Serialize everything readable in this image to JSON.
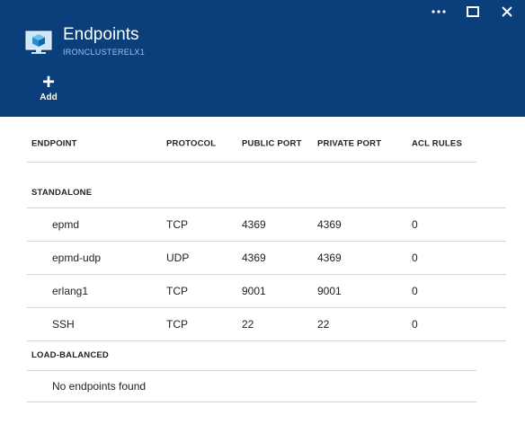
{
  "blade": {
    "title": "Endpoints",
    "subtitle": "IRONCLUSTERELX1",
    "icon": "virtual-machine-icon",
    "window_controls": [
      "ellipsis-icon",
      "maximize-icon",
      "close-icon"
    ]
  },
  "commands": {
    "add_label": "Add"
  },
  "table": {
    "headers": [
      "ENDPOINT",
      "PROTOCOL",
      "PUBLIC PORT",
      "PRIVATE PORT",
      "ACL RULES"
    ],
    "groups": [
      {
        "name": "STANDALONE",
        "rows": [
          [
            "epmd",
            "TCP",
            "4369",
            "4369",
            "0"
          ],
          [
            "epmd-udp",
            "UDP",
            "4369",
            "4369",
            "0"
          ],
          [
            "erlang1",
            "TCP",
            "9001",
            "9001",
            "0"
          ],
          [
            "SSH",
            "TCP",
            "22",
            "22",
            "0"
          ]
        ]
      },
      {
        "name": "LOAD-BALANCED",
        "rows": [],
        "empty_text": "No endpoints found"
      }
    ]
  },
  "colors": {
    "header_bg": "#0b3f7b",
    "subtitle": "#9ec3ee",
    "divider": "#d6d6d6"
  }
}
